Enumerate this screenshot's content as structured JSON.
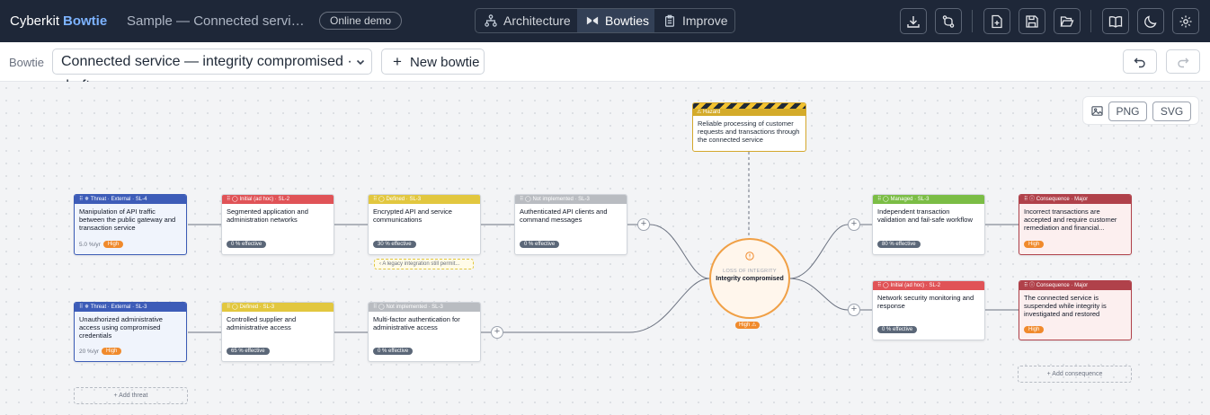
{
  "app": {
    "name": "Cyberkit",
    "module": "Bowtie",
    "sample_title": "Sample — Connected service integrity compromised",
    "demo_badge": "Online demo"
  },
  "nav": {
    "tabs": [
      {
        "label": "Architecture",
        "icon": "architecture-icon"
      },
      {
        "label": "Bowties",
        "icon": "bowtie-icon",
        "active": true
      },
      {
        "label": "Improve",
        "icon": "clipboard-icon"
      }
    ]
  },
  "toolbar": {
    "icons": [
      "download-icon",
      "branch-icon",
      "new-file-icon",
      "save-icon",
      "folder-open-icon",
      "book-icon",
      "moon-icon",
      "gear-icon"
    ]
  },
  "subbar": {
    "label": "Bowtie",
    "selected": "Connected service — integrity compromised · draft",
    "new_label": "New bowtie"
  },
  "export": {
    "png": "PNG",
    "svg": "SVG"
  },
  "hazard": {
    "header": "Hazard",
    "text": "Reliable processing of customer requests and transactions through the connected service"
  },
  "event": {
    "kind": "LOSS OF INTEGRITY",
    "title": "Integrity compromised",
    "severity": "High ⚠"
  },
  "threats": [
    {
      "header": "Threat · External · SL-4",
      "text": "Manipulation of API traffic between the public gateway and transaction service",
      "freq": "5.0 %/yr",
      "sev": "High"
    },
    {
      "header": "Threat · External · SL-3",
      "text": "Unauthorized administrative access using compromised credentials",
      "freq": "20 %/yr",
      "sev": "High"
    }
  ],
  "barriers_top": [
    {
      "header": "Initial (ad hoc) · SL-2",
      "text": "Segmented application and administration networks",
      "eff": "0 % effective"
    },
    {
      "header": "Defined · SL-3",
      "text": "Encrypted API and service communications",
      "eff": "30 % effective"
    },
    {
      "header": "Not implemented · SL-3",
      "text": "Authenticated API clients and command messages",
      "eff": "0 % effective"
    }
  ],
  "barriers_bottom": [
    {
      "header": "Defined · SL-3",
      "text": "Controlled supplier and administrative access",
      "eff": "65 % effective"
    },
    {
      "header": "Not implemented · SL-3",
      "text": "Multi-factor authentication for administrative access",
      "eff": "0 % effective"
    }
  ],
  "note": "A legacy integration still permit...",
  "recovery": [
    {
      "header": "Managed · SL-3",
      "text": "Independent transaction validation and fail-safe workflow",
      "eff": "80 % effective"
    },
    {
      "header": "Initial (ad hoc) · SL-2",
      "text": "Network security monitoring and response",
      "eff": "0 % effective"
    }
  ],
  "consequences": [
    {
      "header": "Consequence · Major",
      "text": "Incorrect transactions are accepted and require customer remediation and financial...",
      "sev": "High"
    },
    {
      "header": "Consequence · Major",
      "text": "The connected service is suspended while integrity is investigated and restored",
      "sev": "High"
    }
  ],
  "add_threat": "Add threat",
  "add_consequence": "Add consequence"
}
